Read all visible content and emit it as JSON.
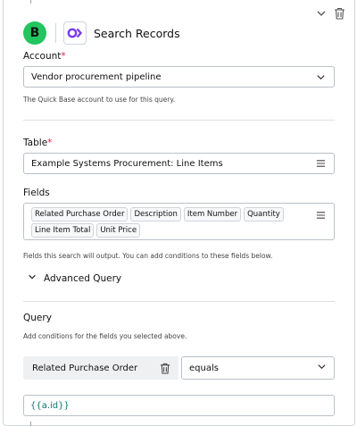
{
  "header": {
    "badge_letter": "B",
    "app_title": "Search Records"
  },
  "account": {
    "label": "Account",
    "required_mark": "*",
    "value": "Vendor procurement pipeline",
    "help": "The Quick Base account to use for this query."
  },
  "table": {
    "label": "Table",
    "required_mark": "*",
    "value": "Example Systems Procurement: Line Items"
  },
  "fields": {
    "label": "Fields",
    "chips": [
      "Related Purchase Order",
      "Description",
      "Item Number",
      "Quantity",
      "Line Item Total",
      "Unit Price"
    ],
    "help": "Fields this search will output. You can add conditions to these fields below."
  },
  "advanced_query": {
    "label": "Advanced Query"
  },
  "query": {
    "label": "Query",
    "help": "Add conditions for the fields you selected above.",
    "condition": {
      "field": "Related Purchase Order",
      "operator": "equals",
      "value": "{{a.id}}"
    }
  },
  "colors": {
    "badge": "#22c55e",
    "logo": "#7c3aed",
    "required": "#e11d48",
    "value_text": "#0f766e"
  }
}
